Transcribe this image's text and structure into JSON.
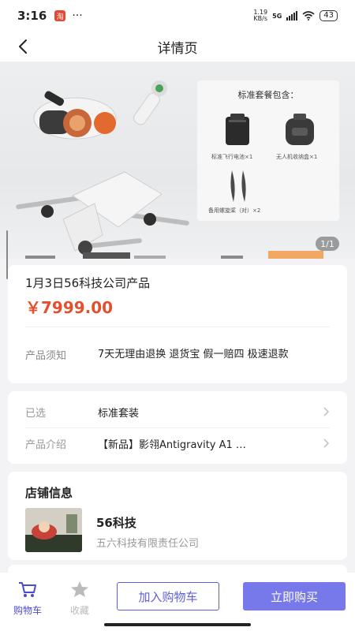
{
  "status_bar": {
    "time": "3:16",
    "notif_badge": "淘",
    "dots": "···",
    "net_speed_value": "1.19",
    "net_speed_unit": "KB/s",
    "network": "5G",
    "battery": "43"
  },
  "nav": {
    "title": "详情页",
    "back_icon": "chevron-left-icon"
  },
  "hero": {
    "package_title": "标准套餐包含：",
    "items": [
      {
        "label": "标准飞行电池×1",
        "icon": "battery-icon"
      },
      {
        "label": "无人机收纳盒×1",
        "icon": "storage-case-icon"
      },
      {
        "label": "备用螺旋桨（对）×2",
        "icon": "propeller-icon"
      }
    ],
    "pager": "1/1"
  },
  "product": {
    "name": "1月3日56科技公司产品",
    "price": "￥7999.00",
    "notice_label": "产品须知",
    "notice_text": "7天无理由退换 退货宝 假一赔四 极速退款"
  },
  "options": {
    "selected_label": "已选",
    "selected_value": "标准套装",
    "intro_label": "产品介绍",
    "intro_value": "【新品】影翎Antigravity A1 …"
  },
  "shop": {
    "section_title": "店铺信息",
    "name": "56科技",
    "company": "五六科技有限责任公司"
  },
  "bottom_bar": {
    "cart_label": "购物车",
    "fav_label": "收藏",
    "add_to_cart": "加入购物车",
    "buy_now": "立即购买"
  },
  "colors": {
    "accent": "#5e5fd9",
    "buy_button": "#7778ea",
    "price": "#e0522f",
    "active_tab": "#4a4bd0",
    "inactive_tab": "#bbbbbb"
  }
}
